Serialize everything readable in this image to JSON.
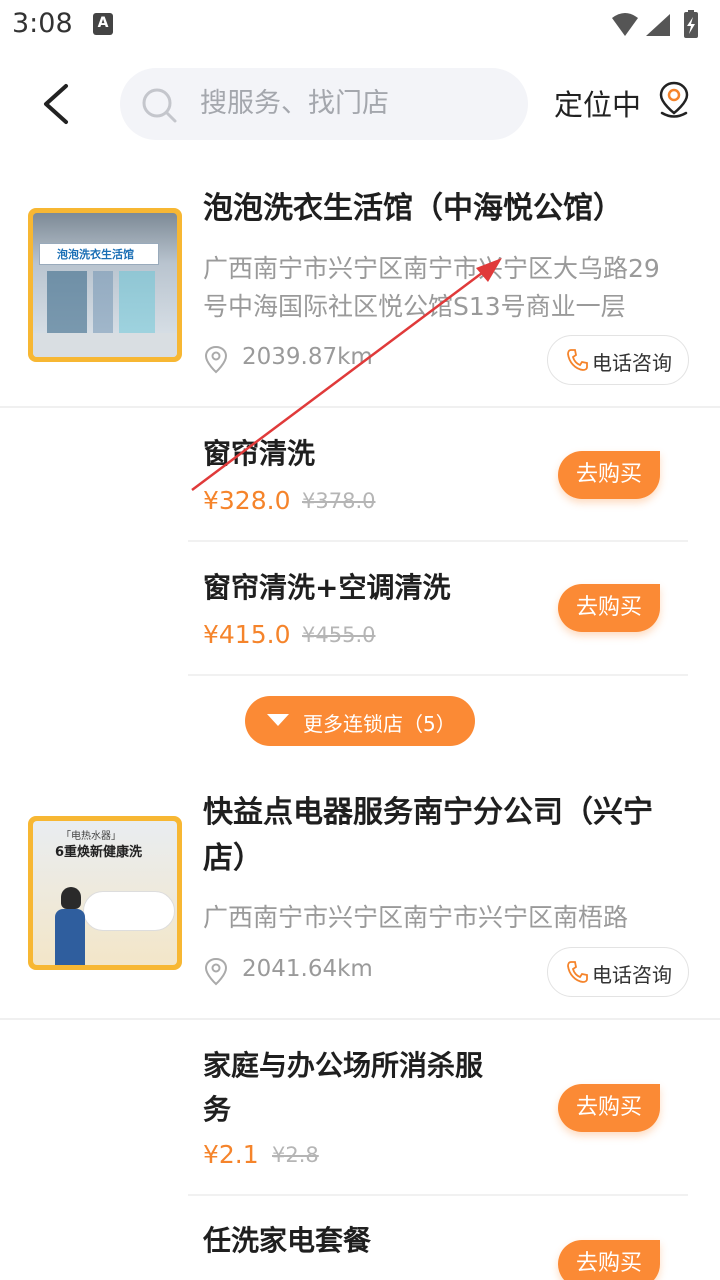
{
  "status_bar": {
    "time": "3:08",
    "notification_glyph": "A"
  },
  "header": {
    "search_placeholder": "搜服务、找门店",
    "location_label": "定位中"
  },
  "stores": [
    {
      "name": "泡泡洗衣生活馆（中海悦公馆）",
      "address": "广西南宁市兴宁区南宁市兴宁区大乌路29号中海国际社区悦公馆S13号商业一层",
      "distance": "2039.87km",
      "call_label": "电话咨询",
      "thumb_sign": "泡泡洗衣生活馆",
      "services": [
        {
          "name": "窗帘清洗",
          "price": "¥328.0",
          "original": "¥378.0",
          "buy": "去购买"
        },
        {
          "name": "窗帘清洗+空调清洗",
          "price": "¥415.0",
          "original": "¥455.0",
          "buy": "去购买"
        }
      ],
      "more_chains": "更多连锁店（5）"
    },
    {
      "name": "快益点电器服务南宁分公司（兴宁店）",
      "address": "广西南宁市兴宁区南宁市兴宁区南梧路",
      "distance": "2041.64km",
      "call_label": "电话咨询",
      "thumb_tag": "「电热水器」",
      "thumb_title": "6重焕新健康洗",
      "services": [
        {
          "name": "家庭与办公场所消杀服务",
          "price": "¥2.1",
          "original": "¥2.8",
          "buy": "去购买"
        },
        {
          "name": "任洗家电套餐",
          "price": "",
          "original": "",
          "buy": "去购买"
        }
      ]
    }
  ],
  "colors": {
    "accent": "#fb8a35",
    "price": "#f5842b",
    "annotation_arrow": "#e03a3a"
  }
}
